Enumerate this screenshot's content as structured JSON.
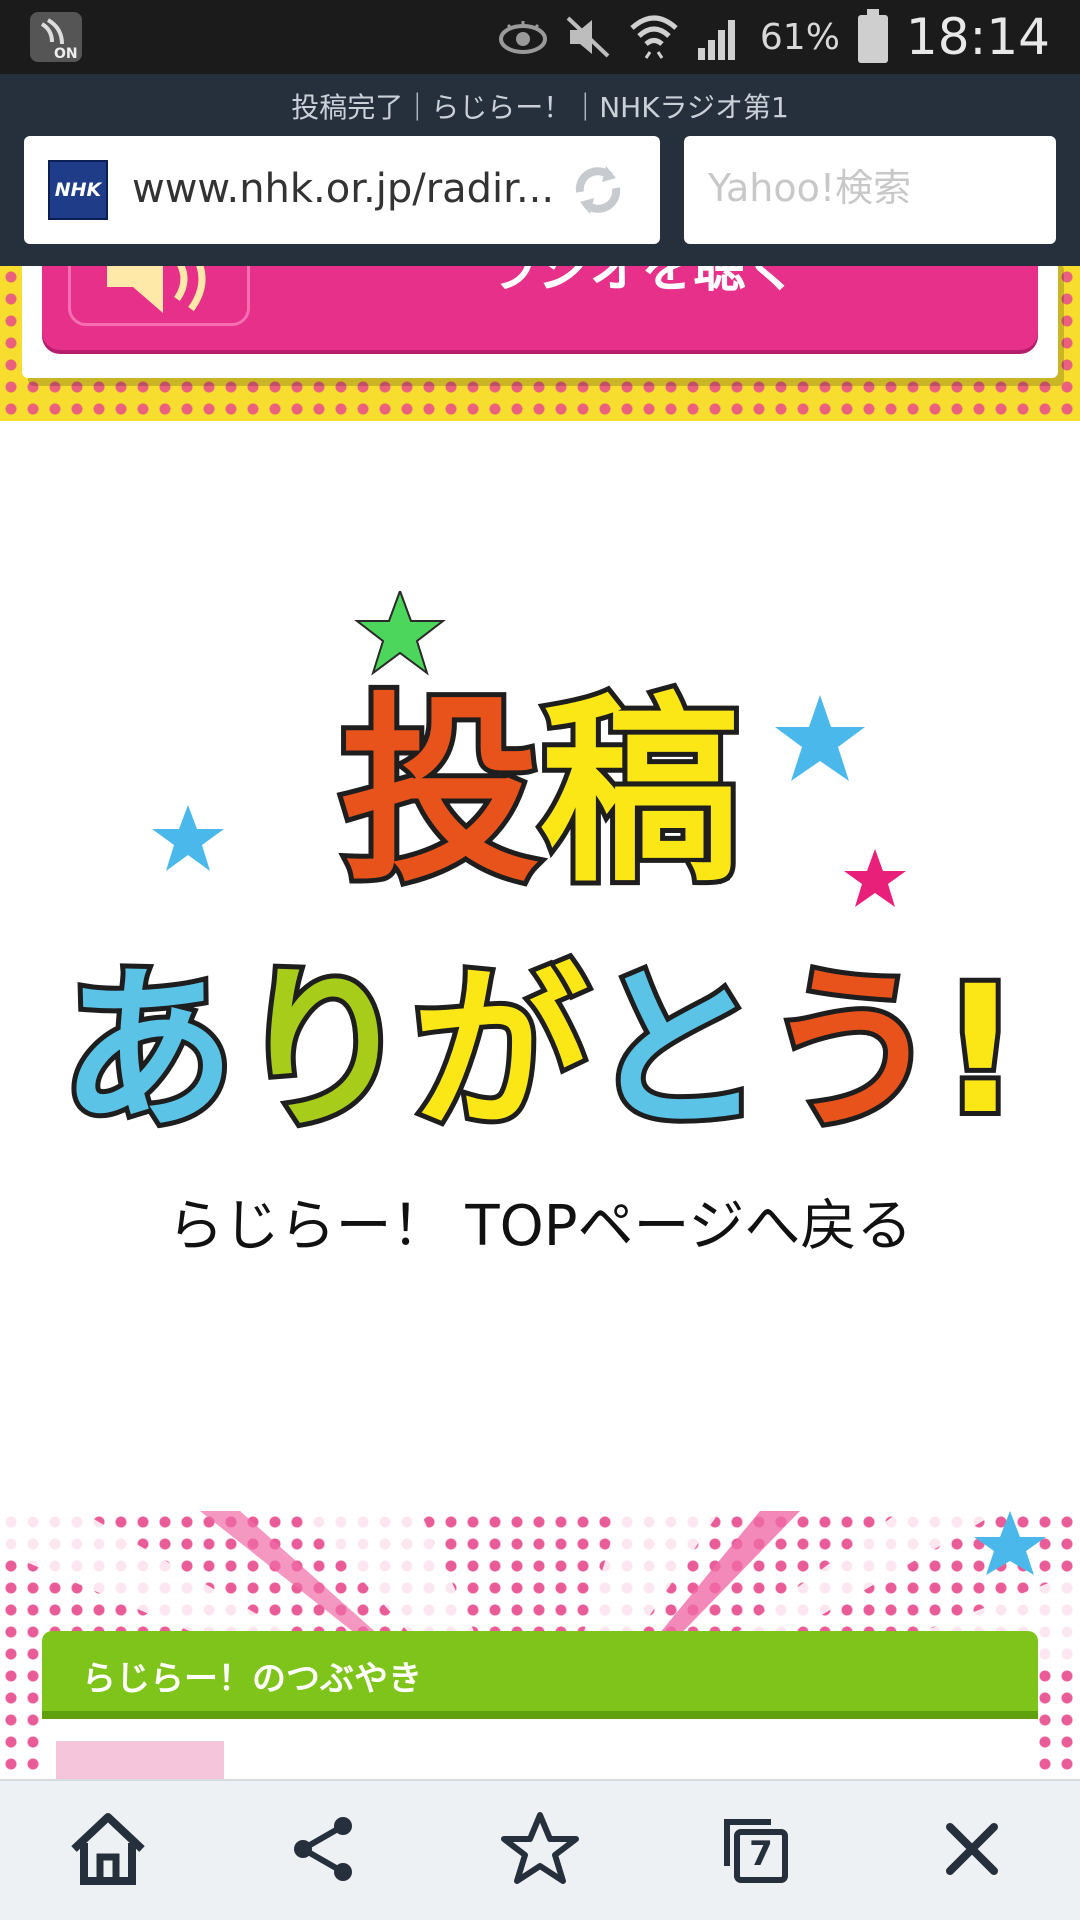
{
  "status_bar": {
    "battery_percent": "61%",
    "time": "18:14",
    "left_icon_label": "ON"
  },
  "browser": {
    "page_title": "投稿完了｜らじらー！｜NHKラジオ第1",
    "url": "www.nhk.or.jp/radir...",
    "site_logo_text": "NHK",
    "search_placeholder": "Yahoo!検索"
  },
  "top_banner": {
    "button_label": "ラジオを聴く"
  },
  "thanks": {
    "heading_line1": "投稿",
    "heading_line2": "ありがとう!",
    "top_link": "らじらー！ TOPページへ戻る",
    "colors": {
      "orange": "#e8531c",
      "yellow": "#fbe715",
      "blue": "#5ac3e6",
      "green": "#a7cc1a",
      "star_green": "#4cd65c",
      "star_blue": "#4ab8ea",
      "star_pink": "#e8207a"
    }
  },
  "tweets": {
    "header": "らじらー！のつぶやき"
  },
  "toolbar": {
    "tabs_count": "7"
  }
}
